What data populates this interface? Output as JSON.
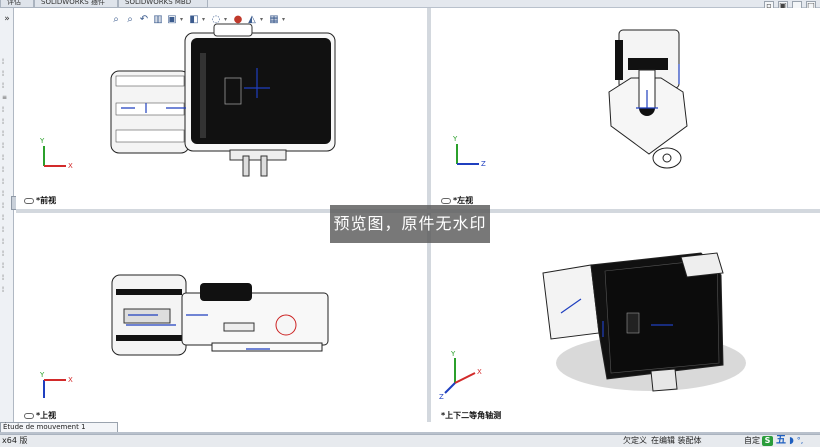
{
  "tabs": [
    "评估",
    "SOLIDWORKS 插件",
    "SOLIDWORKS MBD"
  ],
  "hud_icons": [
    "zoom-to-fit-icon",
    "zoom-area-icon",
    "previous-view-icon",
    "section-view-icon",
    "view-orientation-icon",
    "display-style-icon",
    "hide-show-icon",
    "appearance-icon",
    "scene-icon",
    "view-settings-icon"
  ],
  "left_pane": {
    "expand_label": "»"
  },
  "viewports": {
    "front": {
      "label": "*前视"
    },
    "left": {
      "label": "*左视"
    },
    "top": {
      "label": "*上视"
    },
    "iso": {
      "label": "*上下二等角轴测"
    }
  },
  "watermark": "预览图，原件无水印",
  "motion_tab": "Étude de mouvement 1",
  "status": {
    "left": "x64 版",
    "state": "欠定义",
    "editing": "在编辑 装配体",
    "custom": "自定",
    "ime_s": "S",
    "ime_wu": "五",
    "ime_moon": "◗",
    "ime_deg": "°,"
  },
  "colors": {
    "axis_y": "#2ba02b",
    "axis_z": "#1f3fbf",
    "axis_x": "#d22a2a",
    "model_dark": "#111111",
    "model_light": "#f2f2f2"
  }
}
